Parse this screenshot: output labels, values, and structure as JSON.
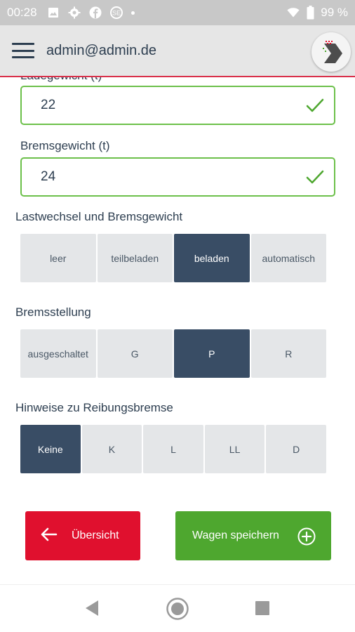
{
  "status_bar": {
    "time": "00:28",
    "battery": "99 %",
    "icons": [
      "image-icon",
      "settings-icon",
      "facebook-icon",
      "app-icon",
      "dot-icon",
      "wifi-icon",
      "battery-icon"
    ]
  },
  "app_bar": {
    "title": "admin@admin.de",
    "menu_icon": "hamburger-menu-icon",
    "logo_icon": "app-logo-icon"
  },
  "form": {
    "partial_label": "Ladegewicht (t)",
    "field1_value": "22",
    "brake_weight_label": "Bremsgewicht (t)",
    "brake_weight_value": "24",
    "load_change_label": "Lastwechsel und Bremsgewicht",
    "load_change_options": [
      "leer",
      "teilbeladen",
      "beladen",
      "automatisch"
    ],
    "load_change_selected": "beladen",
    "brake_setting_label": "Bremsstellung",
    "brake_setting_options": [
      "ausgeschaltet",
      "G",
      "P",
      "R"
    ],
    "brake_setting_selected": "P",
    "friction_brake_label": "Hinweise zu Reibungsbremse",
    "friction_brake_options": [
      "Keine",
      "K",
      "L",
      "LL",
      "D"
    ],
    "friction_brake_selected": "Keine"
  },
  "buttons": {
    "back_label": "Übersicht",
    "save_label": "Wagen speichern"
  },
  "colors": {
    "accent_dark": "#394d65",
    "valid_green": "#6cc04a",
    "danger_red": "#e0102e",
    "save_green": "#4ea72f"
  }
}
